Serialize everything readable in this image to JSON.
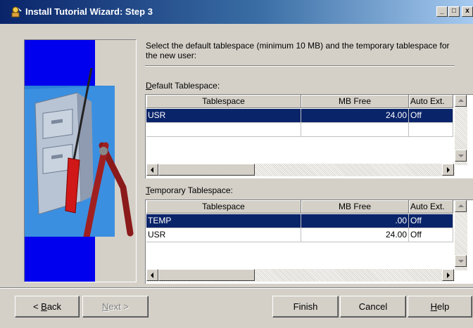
{
  "window": {
    "title": "Install Tutorial Wizard: Step 3",
    "controls": {
      "minimize": "_",
      "maximize": "□",
      "close": "x"
    }
  },
  "graphic": {
    "icon": "file-cabinet-tools-image"
  },
  "prompt": "Select the default tablespace (minimum 10 MB) and the temporary tablespace for the new user:",
  "default_section": {
    "label_first": "D",
    "label_rest": "efault Tablespace:",
    "columns": [
      "Tablespace",
      "MB Free",
      "Auto Ext."
    ],
    "rows": [
      {
        "tablespace": "USR",
        "mb_free": "24.00",
        "auto_ext": "Off",
        "selected": true
      }
    ]
  },
  "temporary_section": {
    "label_first": "T",
    "label_rest": "emporary Tablespace:",
    "columns": [
      "Tablespace",
      "MB Free",
      "Auto Ext."
    ],
    "rows": [
      {
        "tablespace": "TEMP",
        "mb_free": ".00",
        "auto_ext": "Off",
        "selected": true
      },
      {
        "tablespace": "USR",
        "mb_free": "24.00",
        "auto_ext": "Off",
        "selected": false
      }
    ]
  },
  "buttons": {
    "back_accel": "B",
    "back_rest": "ack",
    "back_prefix": "< ",
    "next_accel": "N",
    "next_rest": "ext >",
    "finish": "Finish",
    "cancel": "Cancel",
    "help_accel": "H",
    "help_rest": "elp"
  },
  "colors": {
    "selection": "#0a246a",
    "face": "#d4d0c8",
    "title_start": "#0a246a",
    "title_end": "#a6caf0"
  }
}
